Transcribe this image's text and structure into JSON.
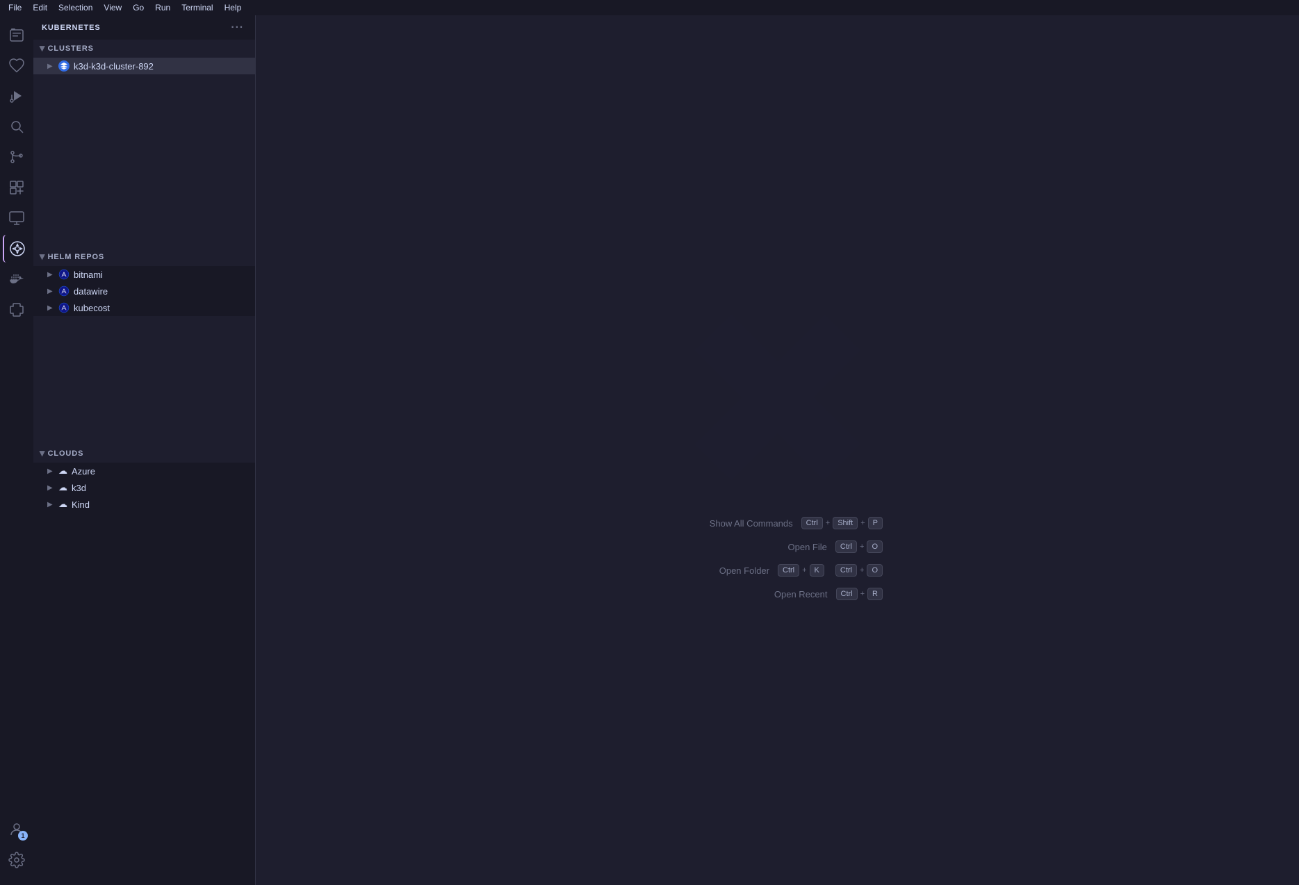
{
  "menu": {
    "items": [
      "File",
      "Edit",
      "Selection",
      "View",
      "Go",
      "Run",
      "Terminal",
      "Help"
    ]
  },
  "activity_bar": {
    "items": [
      {
        "id": "explorer",
        "icon": "📋",
        "label": "Explorer"
      },
      {
        "id": "source-control",
        "icon": "♡",
        "label": "Source Control"
      },
      {
        "id": "run",
        "icon": "▷",
        "label": "Run and Debug"
      },
      {
        "id": "search",
        "icon": "🔍",
        "label": "Search"
      },
      {
        "id": "git",
        "icon": "⑂",
        "label": "Source Control"
      },
      {
        "id": "extensions",
        "icon": "⊞",
        "label": "Extensions"
      },
      {
        "id": "remote",
        "icon": "🖥",
        "label": "Remote Explorer"
      },
      {
        "id": "kubernetes",
        "icon": "⚙",
        "label": "Kubernetes",
        "active": true
      },
      {
        "id": "docker",
        "icon": "🐳",
        "label": "Docker"
      },
      {
        "id": "extensions2",
        "icon": "⊟",
        "label": "Extensions"
      }
    ],
    "bottom": [
      {
        "id": "account",
        "icon": "👤",
        "label": "Account",
        "badge": "1"
      },
      {
        "id": "settings",
        "icon": "⚙",
        "label": "Settings"
      }
    ]
  },
  "sidebar": {
    "title": "KUBERNETES",
    "more_actions_label": "···",
    "sections": {
      "clusters": {
        "label": "CLUSTERS",
        "expanded": true,
        "items": [
          {
            "id": "k3d-cluster",
            "label": "k3d-k3d-cluster-892",
            "has_children": true
          }
        ]
      },
      "helm_repos": {
        "label": "HELM REPOS",
        "expanded": true,
        "items": [
          {
            "id": "bitnami",
            "label": "bitnami",
            "has_children": true
          },
          {
            "id": "datawire",
            "label": "datawire",
            "has_children": true
          },
          {
            "id": "kubecost",
            "label": "kubecost",
            "has_children": true
          }
        ]
      },
      "clouds": {
        "label": "CLOUDS",
        "expanded": true,
        "items": [
          {
            "id": "azure",
            "label": "Azure",
            "has_children": true
          },
          {
            "id": "k3d",
            "label": "k3d",
            "has_children": true
          },
          {
            "id": "kind",
            "label": "Kind",
            "has_children": true
          }
        ]
      }
    }
  },
  "welcome": {
    "commands": [
      {
        "label": "Show All Commands",
        "keys": [
          {
            "key": "Ctrl"
          },
          {
            "sep": "+"
          },
          {
            "key": "Shift"
          },
          {
            "sep": "+"
          },
          {
            "key": "P"
          }
        ]
      },
      {
        "label": "Open File",
        "keys": [
          {
            "key": "Ctrl"
          },
          {
            "sep": "+"
          },
          {
            "key": "O"
          }
        ]
      },
      {
        "label": "Open Folder",
        "keys_groups": [
          [
            {
              "key": "Ctrl"
            },
            {
              "sep": "+"
            },
            {
              "key": "K"
            }
          ],
          [
            {
              "key": "Ctrl"
            },
            {
              "sep": "+"
            },
            {
              "key": "O"
            }
          ]
        ]
      },
      {
        "label": "Open Recent",
        "keys": [
          {
            "key": "Ctrl"
          },
          {
            "sep": "+"
          },
          {
            "key": "R"
          }
        ]
      }
    ]
  }
}
